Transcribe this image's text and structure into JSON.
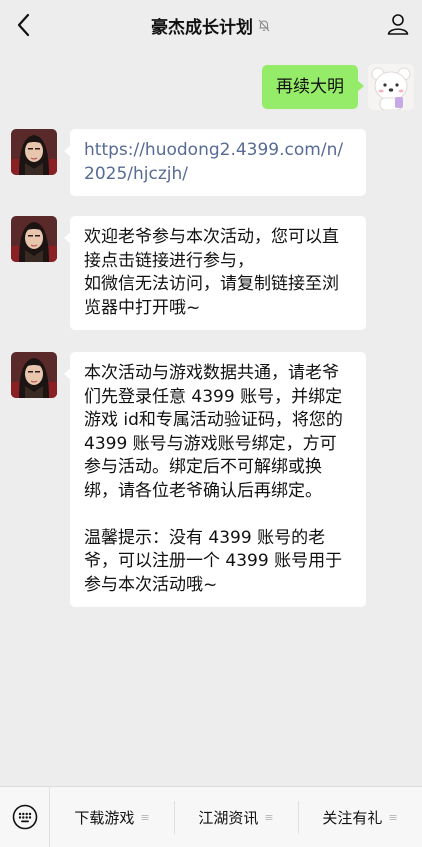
{
  "header": {
    "title": "豪杰成长计划",
    "back_icon": "back-icon",
    "mute_icon": "bell-muted-icon",
    "user_icon": "user-icon"
  },
  "messages": {
    "outgoing": {
      "text": "再续大明"
    },
    "m1": {
      "link": "https://huodong2.4399.com/n/2025/hjczjh/"
    },
    "m2": {
      "text": "欢迎老爷参与本次活动，您可以直接点击链接进行参与，\n如微信无法访问，请复制链接至浏览器中打开哦~"
    },
    "m3": {
      "text": "本次活动与游戏数据共通，请老爷们先登录任意 4399 账号，并绑定游戏 id和专属活动验证码，将您的 4399 账号与游戏账号绑定，方可参与活动。绑定后不可解绑或换绑，请各位老爷确认后再绑定。\n\n温馨提示：没有 4399 账号的老爷，可以注册一个 4399 账号用于参与本次活动哦~"
    }
  },
  "menu": {
    "items": [
      {
        "label": "下载游戏",
        "icon": "≡"
      },
      {
        "label": "江湖资讯",
        "icon": "≡"
      },
      {
        "label": "关注有礼",
        "icon": "≡"
      }
    ]
  },
  "colors": {
    "bubble_green": "#95ec69",
    "link": "#576b95",
    "background": "#ededed"
  }
}
